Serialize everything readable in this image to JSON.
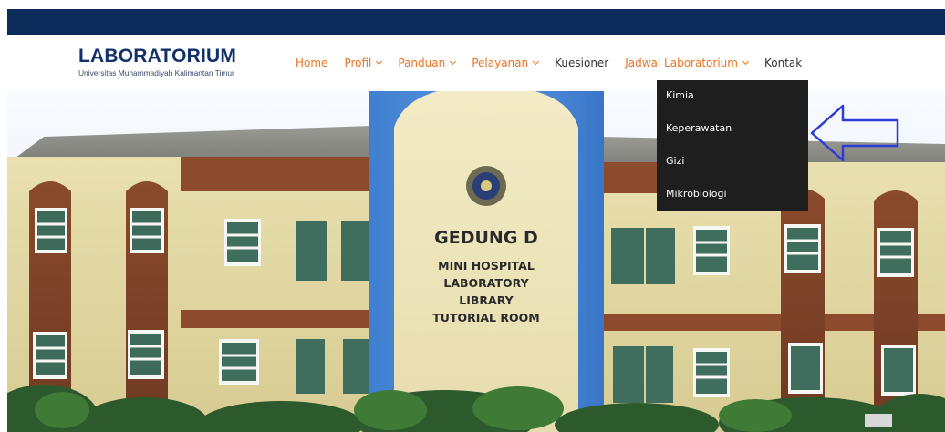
{
  "brand": {
    "title": "LABORATORIUM",
    "subtitle": "Universitas Muhammadiyah Kalimantan Timur"
  },
  "nav": {
    "items": [
      {
        "label": "Home",
        "has_caret": false,
        "color": "#e87422"
      },
      {
        "label": "Profil",
        "has_caret": true,
        "color": "#e87422"
      },
      {
        "label": "Panduan",
        "has_caret": true,
        "color": "#e87422"
      },
      {
        "label": "Pelayanan",
        "has_caret": true,
        "color": "#e87422"
      },
      {
        "label": "Kuesioner",
        "has_caret": false,
        "color": "#333333"
      },
      {
        "label": "Jadwal Laboratorium",
        "has_caret": true,
        "color": "#e87422"
      },
      {
        "label": "Kontak",
        "has_caret": false,
        "color": "#333333"
      }
    ]
  },
  "dropdown": {
    "items": [
      "Kimia",
      "Keperawatan",
      "Gizi",
      "Mikrobiologi"
    ]
  },
  "hero": {
    "sign_lines": [
      "GEDUNG D",
      "MINI HOSPITAL",
      "LABORATORY",
      "LIBRARY",
      "TUTORIAL ROOM"
    ]
  },
  "colors": {
    "topbar": "#0c2a5a",
    "accent": "#e87422",
    "brand": "#12306a",
    "dropdown_bg": "#1e1e1e",
    "arrow": "#2e3bd6"
  }
}
